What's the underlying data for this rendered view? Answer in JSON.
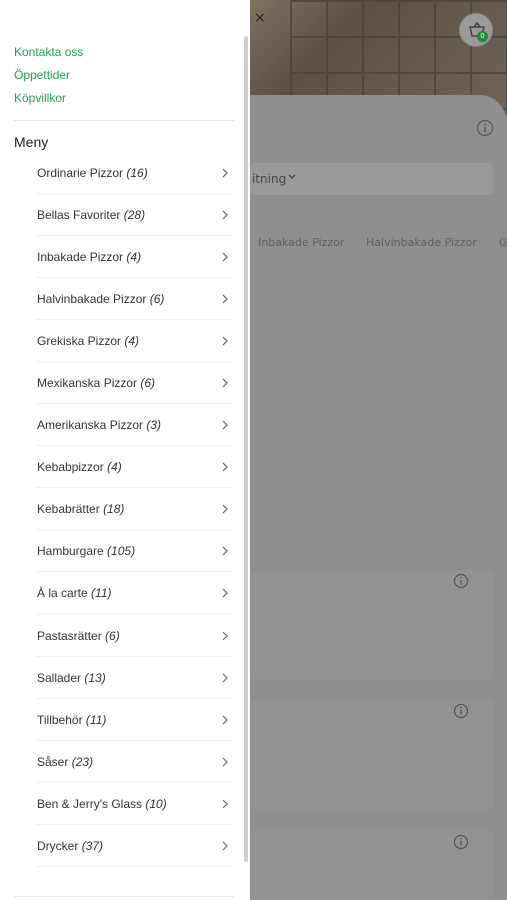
{
  "header": {
    "close_glyph": "×",
    "cart_count": "0"
  },
  "background": {
    "select_label": "itning",
    "category_tabs": [
      "Inbakade Pizzor",
      "Halvinbakade Pizzor",
      "G"
    ]
  },
  "drawer": {
    "top_links": [
      "Kontakta oss",
      "Öppettider",
      "Köpvillkor"
    ],
    "menu_heading": "Meny",
    "menu_items": [
      {
        "label": "Ordinarie Pizzor",
        "count": "(16)"
      },
      {
        "label": "Bellas Favoriter",
        "count": "(28)"
      },
      {
        "label": "Inbakade Pizzor",
        "count": "(4)"
      },
      {
        "label": "Halvinbakade Pizzor",
        "count": "(6)"
      },
      {
        "label": "Grekiska Pizzor",
        "count": "(4)"
      },
      {
        "label": "Mexikanska Pizzor",
        "count": "(6)"
      },
      {
        "label": "Amerikanska Pizzor",
        "count": "(3)"
      },
      {
        "label": "Kebabpizzor",
        "count": "(4)"
      },
      {
        "label": "Kebabrätter",
        "count": "(18)"
      },
      {
        "label": "Hamburgare",
        "count": "(105)"
      },
      {
        "label": "À la carte",
        "count": "(11)"
      },
      {
        "label": "Pastasrätter",
        "count": "(6)"
      },
      {
        "label": "Sallader",
        "count": "(13)"
      },
      {
        "label": "Tillbehör",
        "count": "(11)"
      },
      {
        "label": "Såser",
        "count": "(23)"
      },
      {
        "label": "Ben & Jerry's Glass",
        "count": "(10)"
      },
      {
        "label": "Drycker",
        "count": "(37)"
      }
    ]
  },
  "colors": {
    "accent_green": "#22a447",
    "cart_badge": "#1e8a3a"
  },
  "icons": {
    "close": "close-icon",
    "cart": "cart-icon",
    "info": "info-icon",
    "chevron": "chevron-right-icon"
  }
}
